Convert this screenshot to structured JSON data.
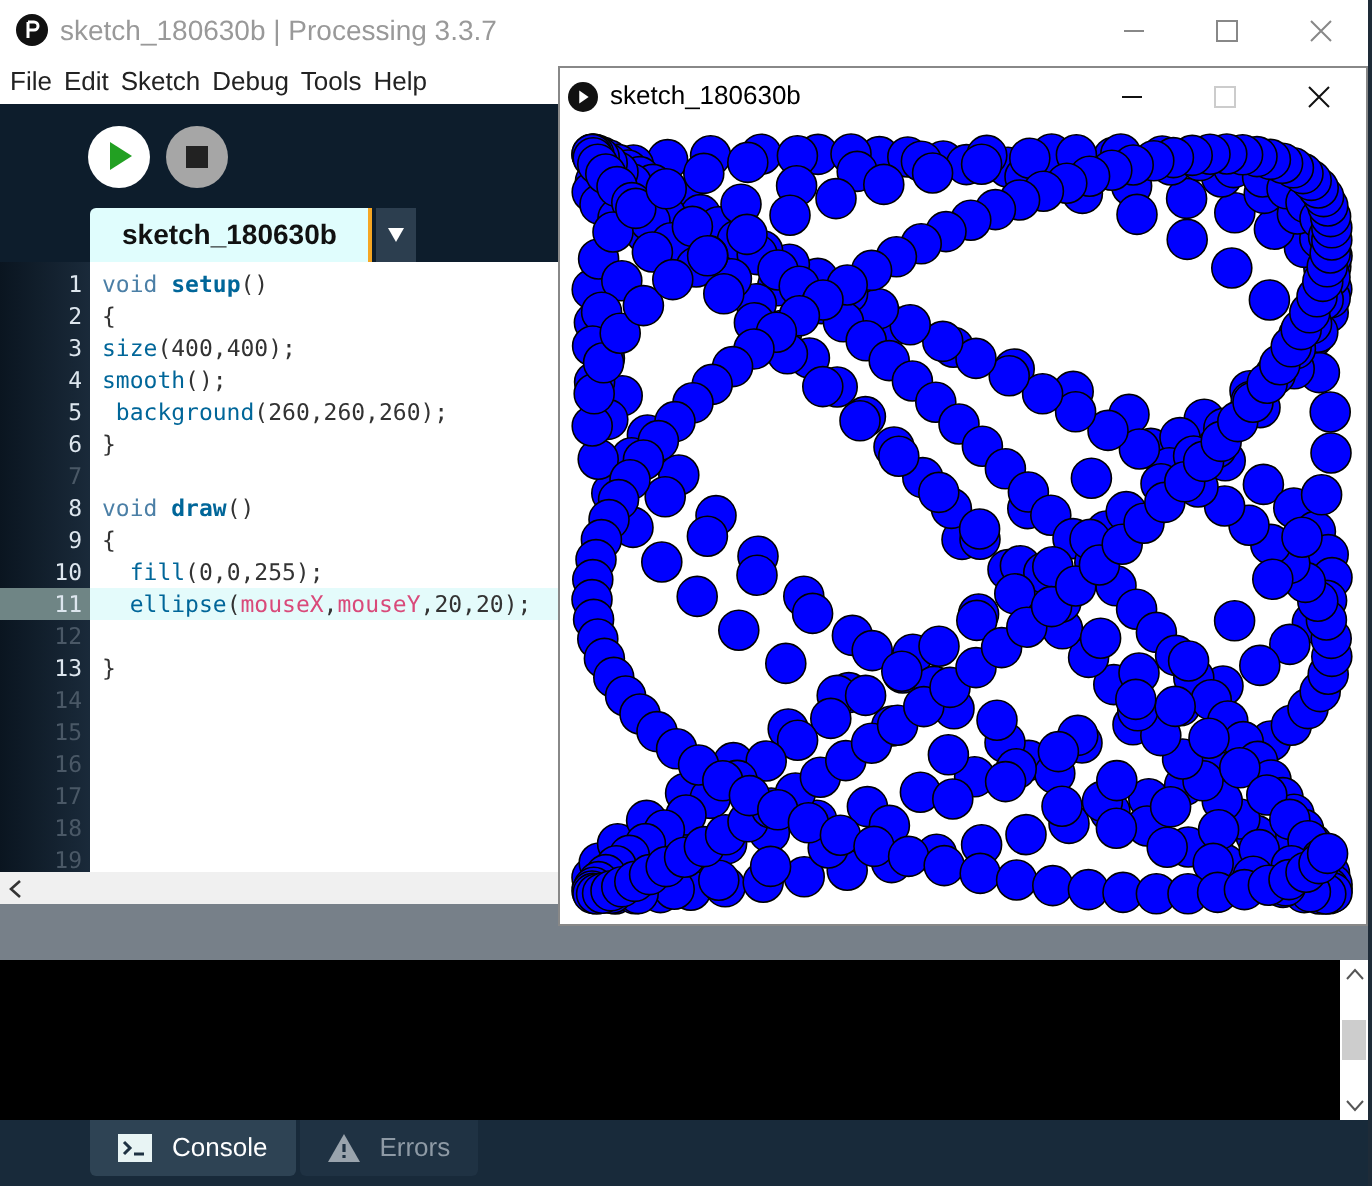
{
  "main_window": {
    "title": "sketch_180630b | Processing 3.3.7"
  },
  "menu": [
    "File",
    "Edit",
    "Sketch",
    "Debug",
    "Tools",
    "Help"
  ],
  "editor_tabs": [
    {
      "label": "sketch_180630b",
      "selected": true
    }
  ],
  "code_lines": [
    {
      "number": "1",
      "selected": false,
      "segments": [
        {
          "text": "void ",
          "kind": "keyword"
        },
        {
          "text": "setup",
          "kind": "bold"
        },
        {
          "text": "()",
          "kind": "plain"
        }
      ]
    },
    {
      "number": "2",
      "selected": false,
      "segments": [
        {
          "text": "{",
          "kind": "plain"
        }
      ]
    },
    {
      "number": "3",
      "selected": false,
      "segments": [
        {
          "text": "size",
          "kind": "function"
        },
        {
          "text": "(400,400);",
          "kind": "plain"
        }
      ]
    },
    {
      "number": "4",
      "selected": false,
      "segments": [
        {
          "text": "smooth",
          "kind": "function"
        },
        {
          "text": "();",
          "kind": "plain"
        }
      ]
    },
    {
      "number": "5",
      "selected": false,
      "segments": [
        {
          "text": " background",
          "kind": "function"
        },
        {
          "text": "(260,260,260);",
          "kind": "plain"
        }
      ]
    },
    {
      "number": "6",
      "selected": false,
      "segments": [
        {
          "text": "}",
          "kind": "plain"
        }
      ]
    },
    {
      "number": "7",
      "selected": false
    },
    {
      "number": "8",
      "selected": false,
      "segments": [
        {
          "text": "void ",
          "kind": "keyword"
        },
        {
          "text": "draw",
          "kind": "bold"
        },
        {
          "text": "()",
          "kind": "plain"
        }
      ]
    },
    {
      "number": "9",
      "selected": false,
      "segments": [
        {
          "text": "{",
          "kind": "plain"
        }
      ]
    },
    {
      "number": "10",
      "selected": false,
      "segments": [
        {
          "text": "  fill",
          "kind": "function"
        },
        {
          "text": "(0,0,255);",
          "kind": "plain"
        }
      ]
    },
    {
      "number": "11",
      "selected": true,
      "segments": [
        {
          "text": "  ellipse",
          "kind": "function"
        },
        {
          "text": "(",
          "kind": "plain"
        },
        {
          "text": "mouseX",
          "kind": "variable"
        },
        {
          "text": ",",
          "kind": "plain"
        },
        {
          "text": "mouseY",
          "kind": "variable"
        },
        {
          "text": ",20,20);",
          "kind": "plain"
        }
      ]
    },
    {
      "number": "12",
      "selected": false
    },
    {
      "number": "13",
      "selected": false,
      "segments": [
        {
          "text": "}",
          "kind": "plain"
        }
      ]
    },
    {
      "number": "14",
      "selected": false
    },
    {
      "number": "15",
      "selected": false
    },
    {
      "number": "16",
      "selected": false
    },
    {
      "number": "17",
      "selected": false
    },
    {
      "number": "18",
      "selected": false
    },
    {
      "number": "19",
      "selected": false
    }
  ],
  "console_tabs": [
    {
      "label": "Console",
      "selected": true
    },
    {
      "label": "Errors",
      "selected": false
    }
  ],
  "sketch_window": {
    "title": "sketch_180630b"
  }
}
